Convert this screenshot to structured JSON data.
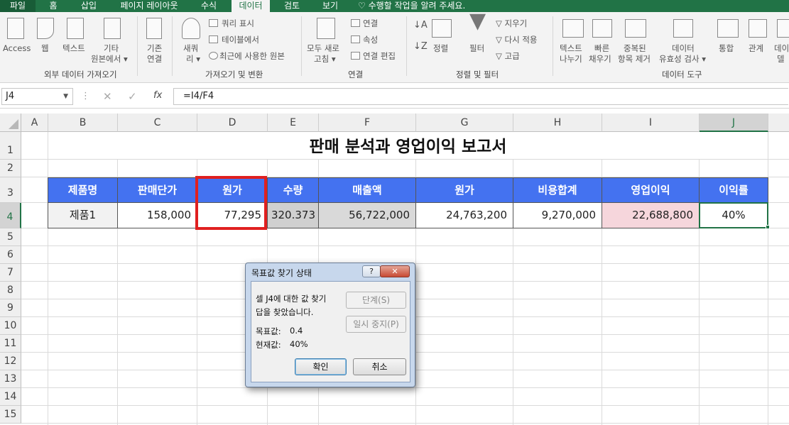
{
  "tabs": [
    "파일",
    "홈",
    "삽입",
    "페이지 레이아웃",
    "수식",
    "데이터",
    "검토",
    "보기"
  ],
  "tell_me": "수행할 작업을 알려 주세요.",
  "ribbon": {
    "access": "Access",
    "web": "웹",
    "text": "텍스트",
    "other_1": "기타",
    "other_2": "원본에서",
    "existing_1": "기존",
    "existing_2": "연결",
    "new_1": "새쿼",
    "new_2": "리",
    "show_query": "쿼리 표시",
    "from_table": "테이블에서",
    "recent": "최근에 사용한 원본",
    "refresh_1": "모두 새로",
    "refresh_2": "고침",
    "conn": "연결",
    "props": "속성",
    "edit_links": "연결 편집",
    "sort": "정렬",
    "filter": "필터",
    "clear": "지우기",
    "reapply": "다시 적용",
    "advanced": "고급",
    "text_to_col_1": "텍스트",
    "text_to_col_2": "나누기",
    "flash_1": "빠른",
    "flash_2": "채우기",
    "dup_1": "중복된",
    "dup_2": "항목 제거",
    "valid_1": "데이터",
    "valid_2": "유효성 검사",
    "consolidate": "통합",
    "relations": "관계",
    "datamodel_1": "데이",
    "datamodel_2": "델",
    "g_external": "외부 데이터 가져오기",
    "g_transform": "가져오기 및 변환",
    "g_connections": "연결",
    "g_sort": "정렬 및 필터",
    "g_tools": "데이터 도구"
  },
  "formula_bar": {
    "name_box": "J4",
    "fx": "fx",
    "formula": "=I4/F4"
  },
  "columns": [
    "A",
    "B",
    "C",
    "D",
    "E",
    "F",
    "G",
    "H",
    "I",
    "J"
  ],
  "rows": [
    "1",
    "2",
    "3",
    "4",
    "5",
    "6",
    "7",
    "8",
    "9",
    "10",
    "11",
    "12",
    "13",
    "14",
    "15"
  ],
  "sheet": {
    "title": "판매 분석과 영업이익 보고서",
    "headers": [
      "제품명",
      "판매단가",
      "원가",
      "수량",
      "매출액",
      "원가",
      "비용합계",
      "영업이익",
      "이익률"
    ],
    "values": [
      "제품1",
      "158,000",
      "77,295",
      "320.373",
      "56,722,000",
      "24,763,200",
      "9,270,000",
      "22,688,800",
      "40%"
    ]
  },
  "dialog": {
    "title": "목표값 찾기 상태",
    "help": "?",
    "close": "✕",
    "line1": "셀 J4에 대한 값 찾기",
    "line2": "답을 찾았습니다.",
    "target_label": "목표값:",
    "target_value": "0.4",
    "current_label": "현재값:",
    "current_value": "40%",
    "step": "단계(S)",
    "pause": "일시 중지(P)",
    "ok": "확인",
    "cancel": "취소"
  },
  "colors": {
    "header_bg": "#4472f0",
    "highlight": "#e02020",
    "sheet_accent": "#217346"
  }
}
